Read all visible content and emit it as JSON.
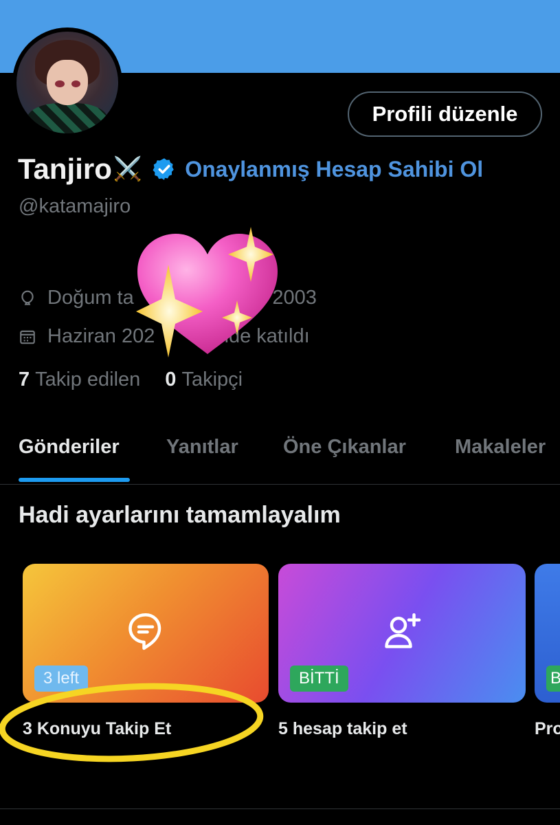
{
  "profile": {
    "display_name": "Tanjiro",
    "swords_emoji": "⚔️",
    "verify_link": "Onaylanmış Hesap Sahibi Ol",
    "handle": "@katamajiro",
    "edit_button": "Profili düzenle",
    "birthday_visible": "Doğum ta",
    "birthday_visible_end": "uz 2003",
    "joined_visible": "Haziran 202",
    "joined_visible_end": "inde katıldı",
    "verified_color": "#1d9bf0",
    "banner_color": "#4b9de8"
  },
  "stats": {
    "following_count": "7",
    "following_label": "Takip edilen",
    "followers_count": "0",
    "followers_label": "Takipçi"
  },
  "tabs": [
    {
      "label": "Gönderiler",
      "active": true
    },
    {
      "label": "Yanıtlar",
      "active": false
    },
    {
      "label": "Öne Çıkanlar",
      "active": false
    },
    {
      "label": "Makaleler",
      "active": false
    }
  ],
  "setup": {
    "title": "Hadi ayarlarını tamamlayalım",
    "cards": [
      {
        "label": "3 Konuyu Takip Et",
        "badge": "3 left",
        "icon": "topic-bubble-icon"
      },
      {
        "label": "5 hesap takip et",
        "badge": "BİTTİ",
        "icon": "add-person-icon"
      },
      {
        "label": "Pro",
        "badge": "BİTTİ",
        "icon": ""
      }
    ]
  },
  "overlays": {
    "sticker": "sparkling-heart",
    "highlight_color": "#f6d523"
  }
}
